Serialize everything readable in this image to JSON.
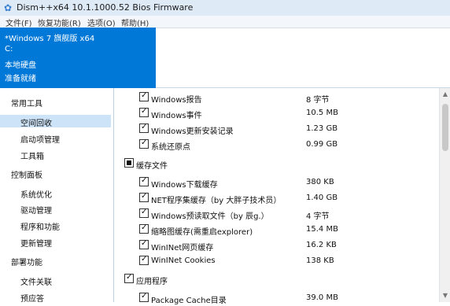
{
  "window": {
    "title": "Dism++x64 10.1.1000.52 Bios Firmware",
    "icon": "settings-icon"
  },
  "menu": [
    "文件(F)",
    "恢复功能(R)",
    "选项(O)",
    "帮助(H)"
  ],
  "info_panel": {
    "lines": [
      "*Windows 7 旗舰版 x64",
      "C:",
      "本地硬盘",
      "准备就绪"
    ],
    "background": "#0078d7"
  },
  "sidebar": {
    "groups": [
      {
        "title": "常用工具",
        "items": [
          "空间回收",
          "启动项管理",
          "工具箱"
        ]
      },
      {
        "title": "控制面板",
        "items": [
          "系统优化",
          "驱动管理",
          "程序和功能",
          "更新管理"
        ]
      },
      {
        "title": "部署功能",
        "items": [
          "文件关联",
          "预应答"
        ]
      }
    ],
    "selected": "空间回收",
    "selected_background": "#cde3f7"
  },
  "cleanup_list": [
    {
      "type": "item",
      "label": "Windows报告",
      "size": "8 字节",
      "checked": true
    },
    {
      "type": "item",
      "label": "Windows事件",
      "size": "10.5 MB",
      "checked": true
    },
    {
      "type": "item",
      "label": "Windows更新安装记录",
      "size": "1.23 GB",
      "checked": true
    },
    {
      "type": "item",
      "label": "系统还原点",
      "size": "0.99 GB",
      "checked": true
    },
    {
      "type": "section",
      "label": "缓存文件",
      "checked": "indeterminate"
    },
    {
      "type": "item",
      "label": "Windows下载缓存",
      "size": "380 KB",
      "checked": true
    },
    {
      "type": "item",
      "label": "NET程序集缓存（by 大胖子技术员）",
      "size": "1.40 GB",
      "checked": true
    },
    {
      "type": "item",
      "label": "Windows预读取文件（by 辰g.）",
      "size": "4 字节",
      "checked": true
    },
    {
      "type": "item",
      "label": "缩略图缓存(需重启explorer)",
      "size": "15.4 MB",
      "checked": true
    },
    {
      "type": "item",
      "label": "WinINet网页缓存",
      "size": "16.2 KB",
      "checked": true
    },
    {
      "type": "item",
      "label": "WinINet Cookies",
      "size": "138 KB",
      "checked": true
    },
    {
      "type": "section",
      "label": "应用程序",
      "checked": true
    },
    {
      "type": "item",
      "label": "Package Cache目录",
      "size": "39.0 MB",
      "checked": true
    }
  ],
  "colors": {
    "titlebar": "#dfeaf7",
    "menubar": "#f3f6fa",
    "sidebar_border": "#bfcde0"
  }
}
